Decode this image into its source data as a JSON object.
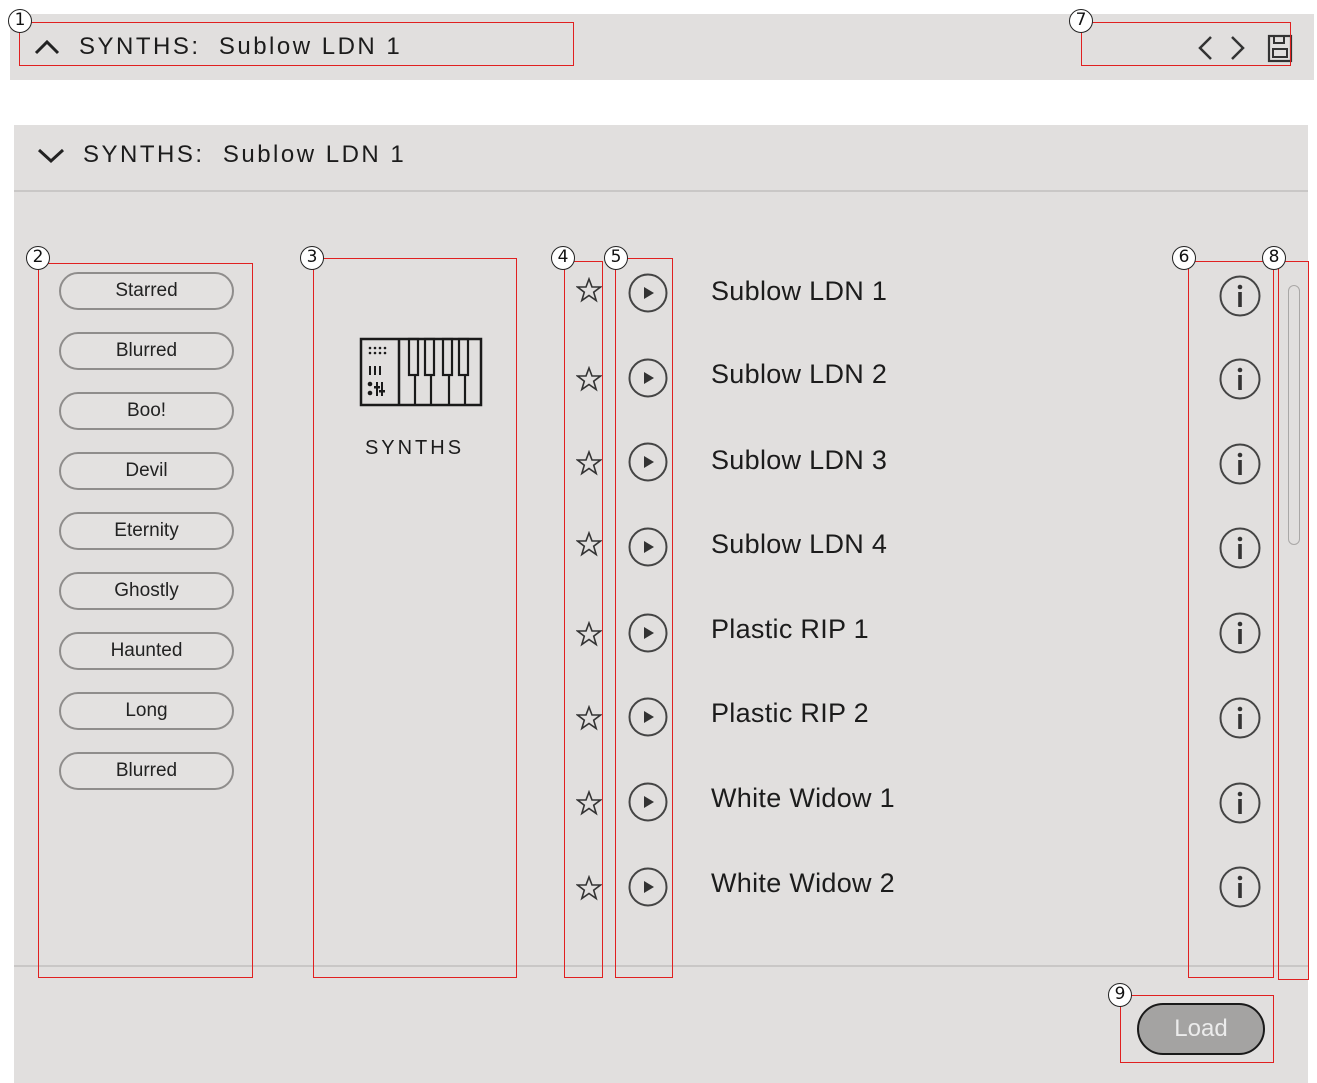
{
  "topbar": {
    "title": "SYNTHS:  Sublow LDN 1",
    "collapse_icon": "chevron-up-icon",
    "prev_icon": "chevron-left-icon",
    "next_icon": "chevron-right-icon",
    "save_icon": "save-icon"
  },
  "panel": {
    "title": "SYNTHS:  Sublow LDN 1",
    "expand_icon": "chevron-down-icon"
  },
  "tags": [
    "Starred",
    "Blurred",
    "Boo!",
    "Devil",
    "Eternity",
    "Ghostly",
    "Haunted",
    "Long",
    "Blurred"
  ],
  "category": {
    "icon": "synth-keyboard-icon",
    "label": "SYNTHS"
  },
  "presets": [
    {
      "name": "Sublow LDN 1"
    },
    {
      "name": "Sublow LDN 2"
    },
    {
      "name": "Sublow LDN 3"
    },
    {
      "name": "Sublow LDN 4"
    },
    {
      "name": "Plastic RIP 1"
    },
    {
      "name": "Plastic RIP 2"
    },
    {
      "name": "White Widow 1"
    },
    {
      "name": "White Widow 2"
    }
  ],
  "load_button": "Load",
  "callouts": [
    "1",
    "2",
    "3",
    "4",
    "5",
    "6",
    "7",
    "8",
    "9"
  ],
  "colors": {
    "panel_bg": "#e1dfde",
    "callout_border": "#e02020",
    "load_button_bg": "#a4a3a2"
  }
}
